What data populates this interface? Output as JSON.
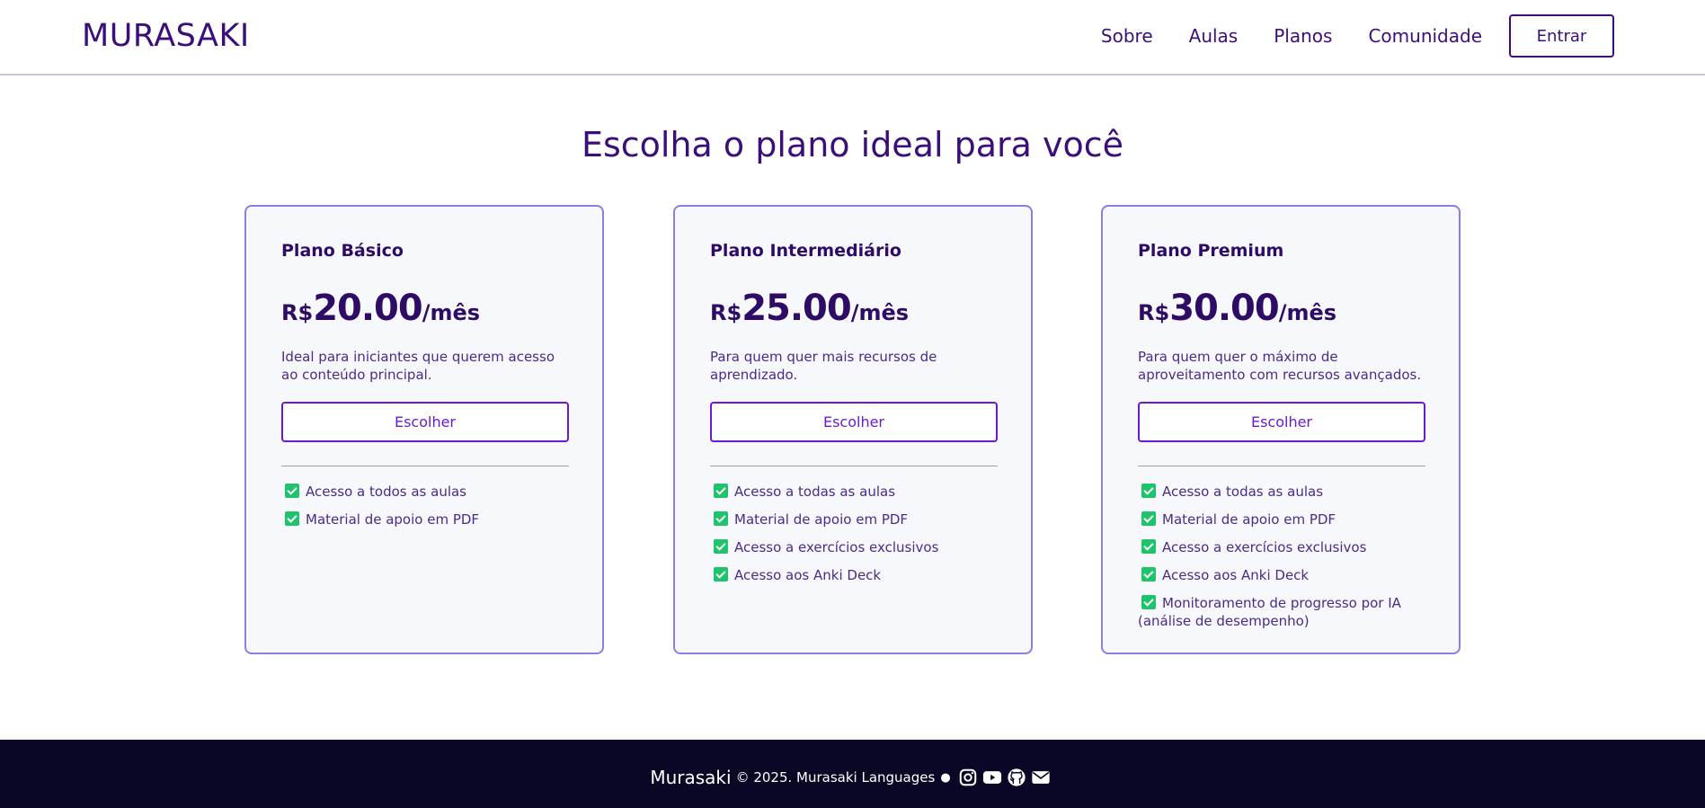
{
  "header": {
    "logo": "MURASAKI",
    "nav": [
      "Sobre",
      "Aulas",
      "Planos",
      "Comunidade"
    ],
    "login_label": "Entrar"
  },
  "main": {
    "title": "Escolha o plano ideal para você",
    "plans": [
      {
        "name": "Plano Básico",
        "currency": "R$",
        "amount": "20.00",
        "period": "/mês",
        "description": "Ideal para iniciantes que querem acesso ao conteúdo principal.",
        "button": "Escolher",
        "features": [
          "Acesso a todos as aulas",
          "Material de apoio em PDF"
        ]
      },
      {
        "name": "Plano Intermediário",
        "currency": "R$",
        "amount": "25.00",
        "period": "/mês",
        "description": "Para quem quer mais recursos de aprendizado.",
        "button": "Escolher",
        "features": [
          "Acesso a todas as aulas",
          "Material de apoio em PDF",
          "Acesso a exercícios exclusivos",
          "Acesso aos Anki Deck"
        ]
      },
      {
        "name": "Plano Premium",
        "currency": "R$",
        "amount": "30.00",
        "period": "/mês",
        "description": "Para quem quer o máximo de aproveitamento com recursos avançados.",
        "button": "Escolher",
        "features": [
          "Acesso a todas as aulas",
          "Material de apoio em PDF",
          "Acesso a exercícios exclusivos",
          "Acesso aos Anki Deck",
          "Monitoramento de progresso por IA (análise de desempenho)"
        ]
      }
    ]
  },
  "footer": {
    "brand": "Murasaki",
    "copyright": "© 2025. Murasaki Languages",
    "separator": "●",
    "icons": [
      "instagram-icon",
      "youtube-icon",
      "github-icon",
      "mail-icon"
    ]
  },
  "colors": {
    "primary": "#3b0f7a",
    "accent": "#6a1ad0",
    "card_border": "#8a7fe8",
    "check": "#1ec46b",
    "footer_bg": "#0a0726"
  }
}
